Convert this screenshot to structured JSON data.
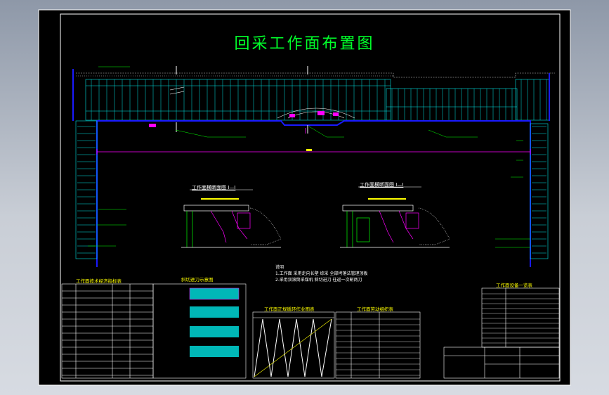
{
  "drawing": {
    "title": "回采工作面布置图"
  },
  "sections": {
    "left_section": "工作面横断面图 I—I",
    "right_section": "工作面横断面图 I—I"
  },
  "tables": {
    "table1": "工作面技术经济指标表",
    "table2": "斜切进刀示意图",
    "table3": "工作面正规循环作业图表",
    "table4": "工作面劳动组织表",
    "table5": "工作面设备一览表"
  },
  "notes": {
    "heading": "说明",
    "line1": "1.工作面 采用走向长壁 综采 全部垮落法管理顶板",
    "line2": "2.采用双滚筒采煤机 斜切进刀 往返一次割两刀"
  },
  "colors": {
    "frame": "#ffffff",
    "cyan": "#00e5e5",
    "blue": "#1010ff",
    "magenta": "#ff00ff",
    "green": "#00ff00",
    "yellow": "#ffff00"
  }
}
